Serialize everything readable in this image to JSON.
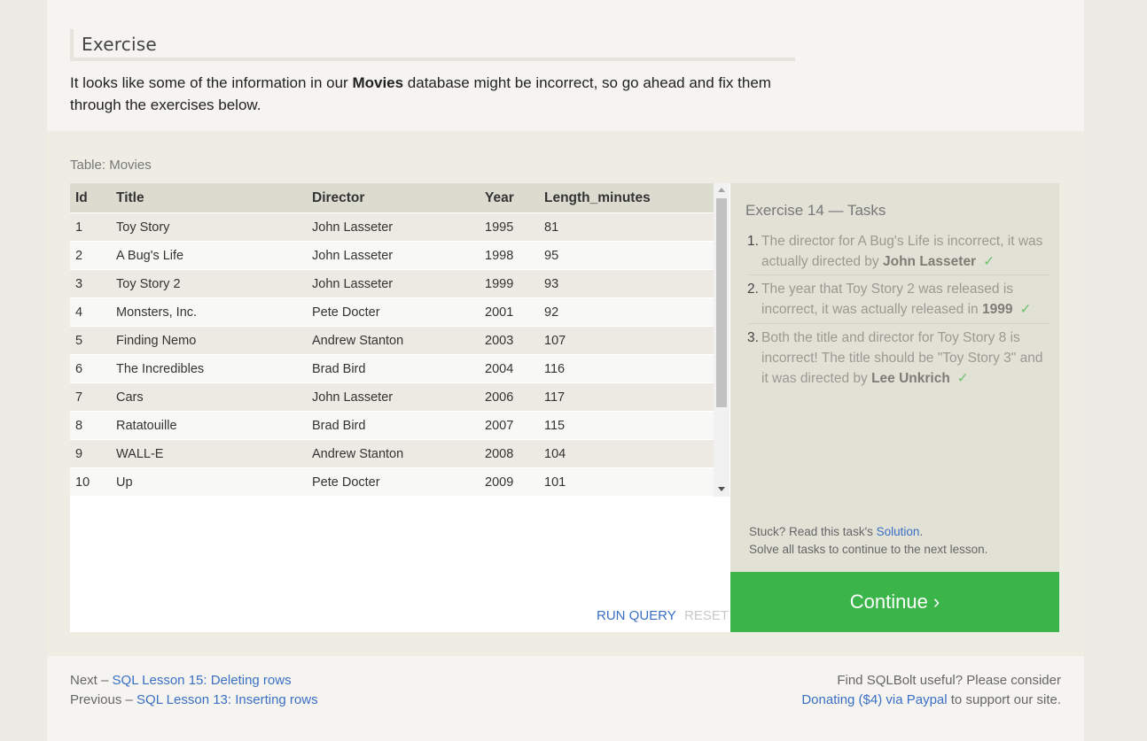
{
  "exercise": {
    "heading": "Exercise",
    "intro_prefix": "It looks like some of the information in our ",
    "intro_bold": "Movies",
    "intro_suffix": " database might be incorrect, so go ahead and fix them through the exercises below."
  },
  "table": {
    "label": "Table: Movies",
    "columns": [
      "Id",
      "Title",
      "Director",
      "Year",
      "Length_minutes"
    ],
    "rows": [
      [
        "1",
        "Toy Story",
        "John Lasseter",
        "1995",
        "81"
      ],
      [
        "2",
        "A Bug's Life",
        "John Lasseter",
        "1998",
        "95"
      ],
      [
        "3",
        "Toy Story 2",
        "John Lasseter",
        "1999",
        "93"
      ],
      [
        "4",
        "Monsters, Inc.",
        "Pete Docter",
        "2001",
        "92"
      ],
      [
        "5",
        "Finding Nemo",
        "Andrew Stanton",
        "2003",
        "107"
      ],
      [
        "6",
        "The Incredibles",
        "Brad Bird",
        "2004",
        "116"
      ],
      [
        "7",
        "Cars",
        "John Lasseter",
        "2006",
        "117"
      ],
      [
        "8",
        "Ratatouille",
        "Brad Bird",
        "2007",
        "115"
      ],
      [
        "9",
        "WALL-E",
        "Andrew Stanton",
        "2008",
        "104"
      ],
      [
        "10",
        "Up",
        "Pete Docter",
        "2009",
        "101"
      ]
    ]
  },
  "buttons": {
    "run_query": "RUN QUERY",
    "reset": "RESET",
    "continue": "Continue ›"
  },
  "tasks": {
    "title": "Exercise 14 — Tasks",
    "items": [
      {
        "num": "1.",
        "text": "The director for A Bug's Life is incorrect, it was actually directed by ",
        "bold": "John Lasseter",
        "check": "✓"
      },
      {
        "num": "2.",
        "text": "The year that Toy Story 2 was released is incorrect, it was actually released in ",
        "bold": "1999",
        "check": "✓"
      },
      {
        "num": "3.",
        "text": "Both the title and director for Toy Story 8 is incorrect! The title should be \"Toy Story 3\" and it was directed by ",
        "bold": "Lee Unkrich",
        "check": "✓"
      }
    ],
    "stuck_prefix": "Stuck? Read this task's ",
    "stuck_link": "Solution",
    "stuck_suffix": ".",
    "solve_all": "Solve all tasks to continue to the next lesson."
  },
  "footer": {
    "next_prefix": "Next – ",
    "next_link": "SQL Lesson 15: Deleting rows",
    "prev_prefix": "Previous – ",
    "prev_link": "SQL Lesson 13: Inserting rows",
    "promo_line1": "Find SQLBolt useful? Please consider",
    "donate_link": "Donating ($4) via Paypal",
    "promo_suffix": " to support our site."
  },
  "colors": {
    "accent_link": "#3a6fc4",
    "continue_green": "#3bb44a",
    "check_green": "#6fc36f"
  }
}
